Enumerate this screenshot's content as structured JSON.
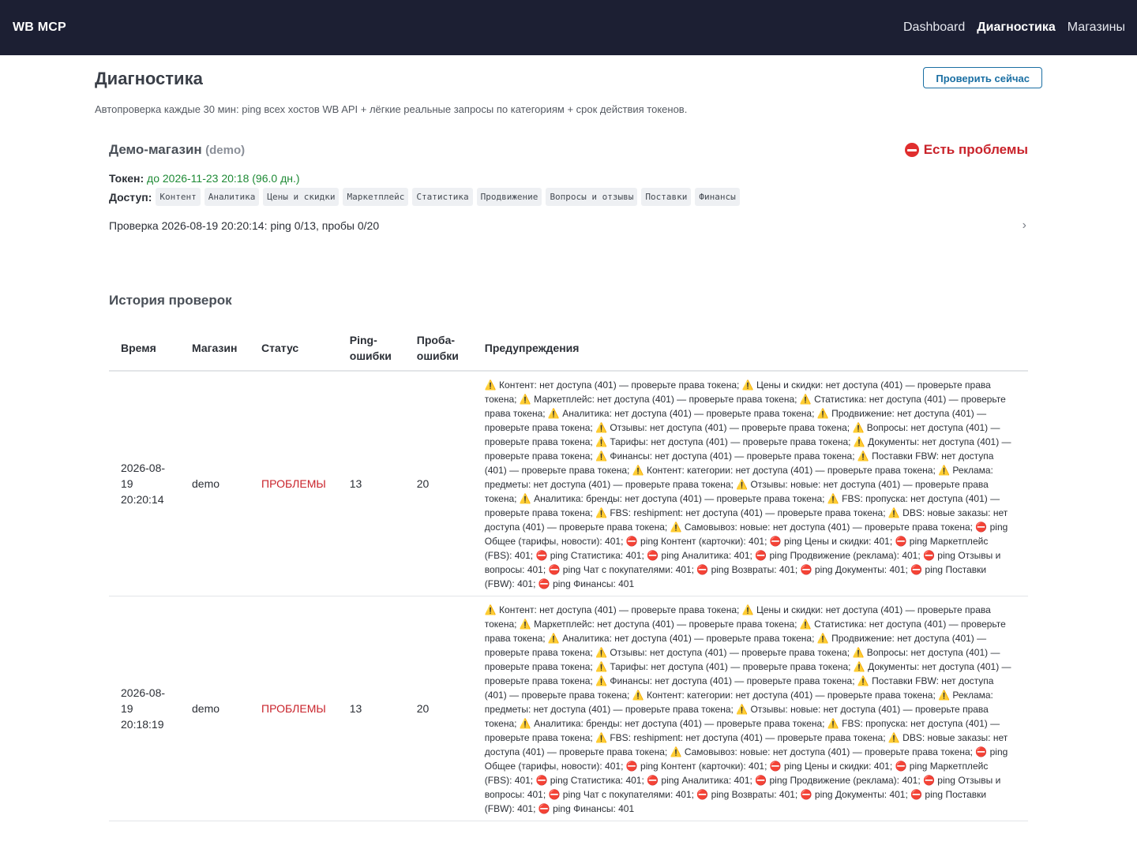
{
  "header": {
    "brand": "WB MCP",
    "nav": [
      {
        "label": "Dashboard",
        "active": false
      },
      {
        "label": "Диагностика",
        "active": true
      },
      {
        "label": "Магазины",
        "active": false
      }
    ]
  },
  "page": {
    "title": "Диагностика",
    "check_button": "Проверить сейчас",
    "subtitle": "Автопроверка каждые 30 мин: ping всех хостов WB API + лёгкие реальные запросы по категориям + срок действия токенов."
  },
  "store": {
    "name": "Демо-магазин",
    "id": "(demo)",
    "status": "Есть проблемы",
    "status_icon": "stop-icon",
    "token_label": "Токен:",
    "token_value": "до 2026-11-23 20:18 (96.0 дн.)",
    "access_label": "Доступ:",
    "access_chips": [
      "Контент",
      "Аналитика",
      "Цены и скидки",
      "Маркетплейс",
      "Статистика",
      "Продвижение",
      "Вопросы и отзывы",
      "Поставки",
      "Финансы"
    ],
    "last_check": "Проверка 2026-08-19 20:20:14: ping 0/13, пробы 0/20"
  },
  "history": {
    "title": "История проверок",
    "columns": [
      "Время",
      "Магазин",
      "Статус",
      "Ping-ошибки",
      "Проба-ошибки",
      "Предупреждения"
    ],
    "rows": [
      {
        "time": "2026-08-19 20:20:14",
        "store": "demo",
        "status": "ПРОБЛЕМЫ",
        "ping_errors": "13",
        "probe_errors": "20"
      },
      {
        "time": "2026-08-19 20:18:19",
        "store": "demo",
        "status": "ПРОБЛЕМЫ",
        "ping_errors": "13",
        "probe_errors": "20"
      }
    ],
    "warnings": [
      {
        "icon": "⚠️",
        "text": "Контент: нет доступа (401) — проверьте права токена;"
      },
      {
        "icon": "⚠️",
        "text": "Цены и скидки: нет доступа (401) — проверьте права токена;"
      },
      {
        "icon": "⚠️",
        "text": "Маркетплейс: нет доступа (401) — проверьте права токена;"
      },
      {
        "icon": "⚠️",
        "text": "Статистика: нет доступа (401) — проверьте права токена;"
      },
      {
        "icon": "⚠️",
        "text": "Аналитика: нет доступа (401) — проверьте права токена;"
      },
      {
        "icon": "⚠️",
        "text": "Продвижение: нет доступа (401) — проверьте права токена;"
      },
      {
        "icon": "⚠️",
        "text": "Отзывы: нет доступа (401) — проверьте права токена;"
      },
      {
        "icon": "⚠️",
        "text": "Вопросы: нет доступа (401) — проверьте права токена;"
      },
      {
        "icon": "⚠️",
        "text": "Тарифы: нет доступа (401) — проверьте права токена;"
      },
      {
        "icon": "⚠️",
        "text": "Документы: нет доступа (401) — проверьте права токена;"
      },
      {
        "icon": "⚠️",
        "text": "Финансы: нет доступа (401) — проверьте права токена;"
      },
      {
        "icon": "⚠️",
        "text": "Поставки FBW: нет доступа (401) — проверьте права токена;"
      },
      {
        "icon": "⚠️",
        "text": "Контент: категории: нет доступа (401) — проверьте права токена;"
      },
      {
        "icon": "⚠️",
        "text": "Реклама: предметы: нет доступа (401) — проверьте права токена;"
      },
      {
        "icon": "⚠️",
        "text": "Отзывы: новые: нет доступа (401) — проверьте права токена;"
      },
      {
        "icon": "⚠️",
        "text": "Аналитика: бренды: нет доступа (401) — проверьте права токена;"
      },
      {
        "icon": "⚠️",
        "text": "FBS: пропуска: нет доступа (401) — проверьте права токена;"
      },
      {
        "icon": "⚠️",
        "text": "FBS: reshipment: нет доступа (401) — проверьте права токена;"
      },
      {
        "icon": "⚠️",
        "text": "DBS: новые заказы: нет доступа (401) — проверьте права токена;"
      },
      {
        "icon": "⚠️",
        "text": "Самовывоз: новые: нет доступа (401) — проверьте права токена;"
      },
      {
        "icon": "⛔",
        "text": "ping Общее (тарифы, новости): 401;"
      },
      {
        "icon": "⛔",
        "text": "ping Контент (карточки): 401;"
      },
      {
        "icon": "⛔",
        "text": "ping Цены и скидки: 401;"
      },
      {
        "icon": "⛔",
        "text": "ping Маркетплейс (FBS): 401;"
      },
      {
        "icon": "⛔",
        "text": "ping Статистика: 401;"
      },
      {
        "icon": "⛔",
        "text": "ping Аналитика: 401;"
      },
      {
        "icon": "⛔",
        "text": "ping Продвижение (реклама): 401;"
      },
      {
        "icon": "⛔",
        "text": "ping Отзывы и вопросы: 401;"
      },
      {
        "icon": "⛔",
        "text": "ping Чат с покупателями: 401;"
      },
      {
        "icon": "⛔",
        "text": "ping Возвраты: 401;"
      },
      {
        "icon": "⛔",
        "text": "ping Документы: 401;"
      },
      {
        "icon": "⛔",
        "text": "ping Поставки (FBW): 401;"
      },
      {
        "icon": "⛔",
        "text": "ping Финансы: 401"
      }
    ]
  },
  "colors": {
    "topbar": "#1c1f33",
    "problem": "#c9232b",
    "token_ok": "#1e8a35",
    "button": "#1a6fa3"
  }
}
